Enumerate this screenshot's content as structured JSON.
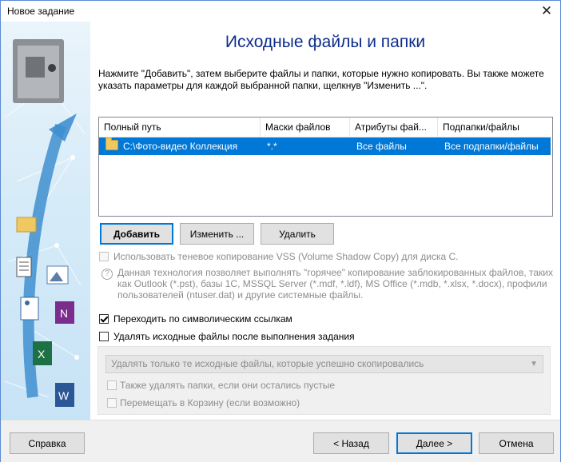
{
  "window": {
    "title": "Новое задание"
  },
  "header": {
    "heading": "Исходные файлы и папки",
    "intro": "Нажмите \"Добавить\", затем выберите файлы и папки, которые нужно копировать. Вы также можете указать параметры для каждой выбранной папки, щелкнув \"Изменить ...\"."
  },
  "list": {
    "columns": [
      "Полный путь",
      "Маски файлов",
      "Атрибуты фай...",
      "Подпапки/файлы"
    ],
    "rows": [
      {
        "path": "C:\\Фото-видео Коллекция",
        "mask": "*.*",
        "attributes": "Все файлы",
        "subfolders": "Все подпапки/файлы"
      }
    ]
  },
  "buttons": {
    "add": "Добавить",
    "edit": "Изменить ...",
    "delete": "Удалить"
  },
  "options": {
    "vss": {
      "label": "Использовать теневое копирование VSS (Volume Shadow Copy) для диска C.",
      "checked": false,
      "enabled": false
    },
    "vss_note": "Данная технология позволяет выполнять \"горячее\" копирование заблокированных файлов, таких как Outlook (*.pst), базы 1С, MSSQL Server (*.mdf, *.ldf), MS Office (*.mdb, *.xlsx, *.docx), профили пользователей (ntuser.dat) и другие системные файлы.",
    "symlinks": {
      "label": "Переходить по символическим ссылкам",
      "checked": true
    },
    "delete_source": {
      "label": "Удалять исходные файлы после выполнения задания",
      "checked": false
    },
    "delete_mode": {
      "selected": "Удалять только те исходные файлы, которые успешно скопировались"
    },
    "delete_empty_folders": {
      "label": "Также удалять папки, если они остались пустые",
      "checked": false,
      "enabled": false
    },
    "move_to_recycle": {
      "label": "Перемещать в Корзину (если возможно)",
      "checked": false,
      "enabled": false
    }
  },
  "footer": {
    "help": "Справка",
    "back": "< Назад",
    "next": "Далее >",
    "cancel": "Отмена"
  },
  "icons": {
    "close": "close-icon",
    "safe": "safe-icon",
    "folder": "folder-icon",
    "question": "question-icon"
  },
  "colors": {
    "accent": "#0078d7",
    "heading": "#0d2d8c",
    "sidebar": "#d6ebf8"
  }
}
